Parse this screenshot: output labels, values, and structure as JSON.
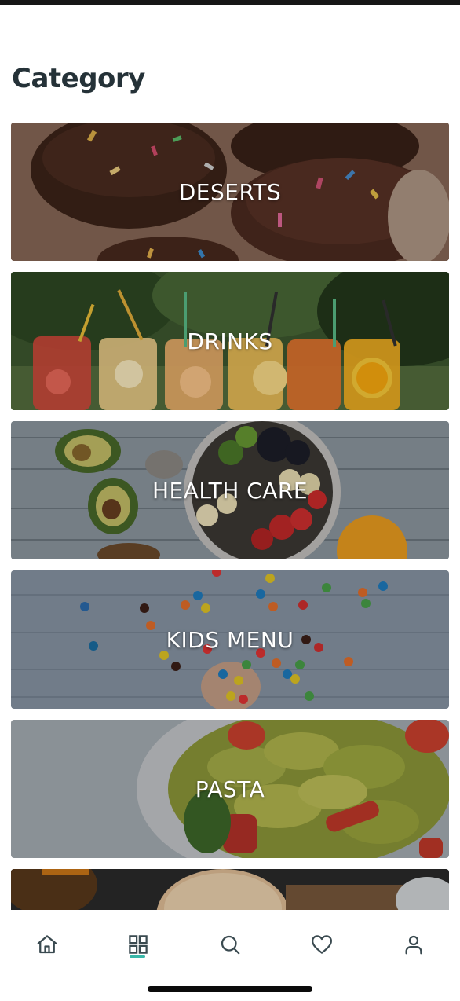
{
  "page": {
    "title": "Category"
  },
  "categories": [
    {
      "label": "DESERTS"
    },
    {
      "label": "DRINKS"
    },
    {
      "label": "HEALTH CARE"
    },
    {
      "label": "KIDS MENU"
    },
    {
      "label": "PASTA"
    }
  ],
  "nav": {
    "items": [
      {
        "name": "home",
        "icon": "home-icon"
      },
      {
        "name": "categories",
        "icon": "grid-icon",
        "active": true
      },
      {
        "name": "search",
        "icon": "search-icon"
      },
      {
        "name": "favorites",
        "icon": "heart-icon"
      },
      {
        "name": "profile",
        "icon": "user-icon"
      }
    ]
  },
  "colors": {
    "title": "#253238",
    "accent": "#39b8a9",
    "icon": "#3a4a50"
  }
}
